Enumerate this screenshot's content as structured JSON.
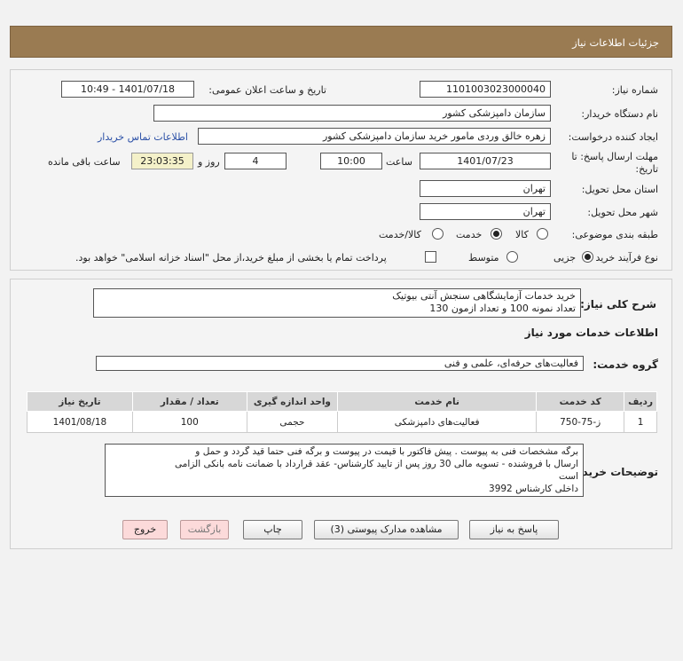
{
  "header": {
    "title": "جزئیات اطلاعات نیاز"
  },
  "form": {
    "need_number_label": "شماره نیاز:",
    "need_number": "1101003023000040",
    "announce_label": "تاریخ و ساعت اعلان عمومی:",
    "announce_value": "1401/07/18 - 10:49",
    "buyer_org_label": "نام دستگاه خریدار:",
    "buyer_org": "سازمان دامپزشکی کشور",
    "creator_label": "ایجاد کننده درخواست:",
    "creator": "زهره خالق وردی مامور خرید سازمان دامپزشکی کشور",
    "contact_link": "اطلاعات تماس خریدار",
    "deadline_label_1": "مهلت ارسال پاسخ: تا",
    "deadline_label_2": "تاریخ:",
    "deadline_date": "1401/07/23",
    "time_label": "ساعت",
    "deadline_time": "10:00",
    "days_value": "4",
    "days_label": "روز و",
    "remaining_time": "23:03:35",
    "remaining_label": "ساعت باقی مانده",
    "province_label": "استان محل تحویل:",
    "province": "تهران",
    "city_label": "شهر محل تحویل:",
    "city": "تهران",
    "category_label": "طبقه بندی موضوعی:",
    "category_options": [
      "کالا",
      "خدمت",
      "کالا/خدمت"
    ],
    "category_selected": "خدمت",
    "process_label": "نوع فرآیند خرید :",
    "process_options": [
      "جزیی",
      "متوسط"
    ],
    "process_selected": "جزیی",
    "payment_text": "پرداخت تمام یا بخشی از مبلغ خرید،از محل \"اسناد خزانه اسلامی\" خواهد بود."
  },
  "summary": {
    "label": "شرح کلی نیاز:",
    "line1": "خرید خدمات آزمایشگاهی سنجش آنتی بیوتیک",
    "line2": "تعداد نمونه 100 و تعداد ازمون 130"
  },
  "services": {
    "section_title": "اطلاعات خدمات مورد نیاز",
    "group_label": "گروه خدمت:",
    "group_value": "فعالیت‌های حرفه‌ای، علمی و فنی",
    "columns": [
      "ردیف",
      "کد خدمت",
      "نام خدمت",
      "واحد اندازه گیری",
      "تعداد / مقدار",
      "تاریخ نیاز"
    ],
    "rows": [
      [
        "1",
        "ز-75-750",
        "فعالیت‌های دامپزشکی",
        "حجمی",
        "100",
        "1401/08/18"
      ]
    ]
  },
  "buyer_notes": {
    "label": "توضیحات خریدار:",
    "line1": "برگه مشخصات فنی به پیوست . پیش فاکتور با قیمت در پیوست و برگه فنی حتما قید گردد و  حمل و",
    "line2": "ارسال با فروشنده - تسویه مالی 30 روز پس از تایید کارشناس- عقد قرارداد با ضمانت نامه بانکی الزامی",
    "line3": "است",
    "line4": "داخلی کارشناس 3992"
  },
  "buttons": {
    "reply": "پاسخ به نیاز",
    "attachments": "مشاهده مدارک پیوستی (3)",
    "print": "چاپ",
    "back": "بازگشت",
    "exit": "خروج"
  }
}
